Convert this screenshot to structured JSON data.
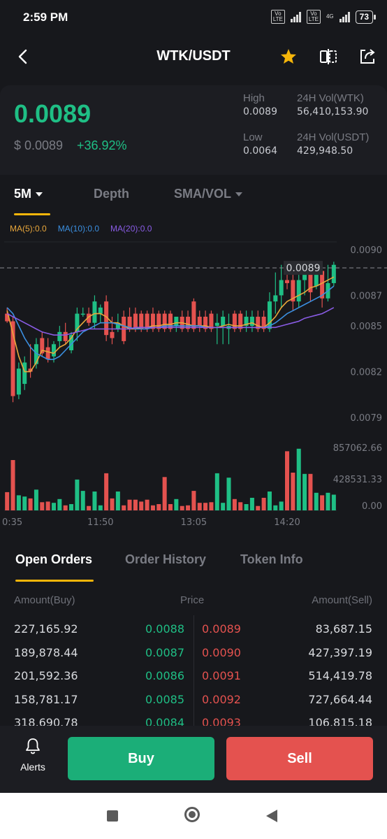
{
  "status": {
    "time": "2:59 PM",
    "sim1": "Vo\nLTE",
    "sim2": "Vo\nLTE",
    "network": "4G",
    "battery": "73"
  },
  "topbar": {
    "title": "WTK/USDT",
    "favorite_icon": "star-icon",
    "compare_icon": "compare-icon",
    "share_icon": "share-icon"
  },
  "ticker": {
    "price": "0.0089",
    "usd_price": "$ 0.0089",
    "change": "+36.92%",
    "high_label": "High",
    "high_value": "0.0089",
    "low_label": "Low",
    "low_value": "0.0064",
    "vol_base_label": "24H Vol(WTK)",
    "vol_base_value": "56,410,153.90",
    "vol_quote_label": "24H Vol(USDT)",
    "vol_quote_value": "429,948.50"
  },
  "chart_tabs": {
    "interval": "5M",
    "depth": "Depth",
    "indicator": "SMA/VOL"
  },
  "ma_legend": {
    "ma5": "MA(5):0.0",
    "ma10": "MA(10):0.0",
    "ma20": "MA(20):0.0"
  },
  "colors": {
    "up": "#1fbf85",
    "down": "#e4524f",
    "ma5": "#e9a73b",
    "ma10": "#3b8fe0",
    "ma20": "#8a5ce6",
    "accent": "#f5b50a"
  },
  "chart_data": {
    "type": "candlestick",
    "y_ticks": [
      "0.0090",
      "0.0087",
      "0.0085",
      "0.0082",
      "0.0079"
    ],
    "ylim": [
      0.00785,
      0.00905
    ],
    "last_price_label": "0.0089",
    "last_price": 0.00888,
    "x_ticks": [
      "0:35",
      "11:50",
      "13:05",
      "14:20"
    ],
    "x_tick_index": [
      0,
      16,
      32,
      48
    ],
    "volume_ticks": [
      "857062.66",
      "428531.33",
      "0.00"
    ],
    "volume_max": 857062.66,
    "candles": [
      {
        "o": 0.00858,
        "h": 0.00862,
        "l": 0.00852,
        "c": 0.00853
      },
      {
        "o": 0.00853,
        "h": 0.00856,
        "l": 0.008,
        "c": 0.00804
      },
      {
        "o": 0.00805,
        "h": 0.00826,
        "l": 0.00802,
        "c": 0.00822
      },
      {
        "o": 0.00812,
        "h": 0.0083,
        "l": 0.00808,
        "c": 0.00826
      },
      {
        "o": 0.00822,
        "h": 0.00838,
        "l": 0.00816,
        "c": 0.0082
      },
      {
        "o": 0.00825,
        "h": 0.00842,
        "l": 0.00822,
        "c": 0.00838
      },
      {
        "o": 0.00842,
        "h": 0.00846,
        "l": 0.0083,
        "c": 0.00832
      },
      {
        "o": 0.00836,
        "h": 0.00842,
        "l": 0.00826,
        "c": 0.00828
      },
      {
        "o": 0.0083,
        "h": 0.0084,
        "l": 0.00826,
        "c": 0.00838
      },
      {
        "o": 0.0084,
        "h": 0.0085,
        "l": 0.00836,
        "c": 0.00846
      },
      {
        "o": 0.00846,
        "h": 0.00852,
        "l": 0.00838,
        "c": 0.0084
      },
      {
        "o": 0.00834,
        "h": 0.00846,
        "l": 0.00832,
        "c": 0.00844
      },
      {
        "o": 0.00846,
        "h": 0.00862,
        "l": 0.0084,
        "c": 0.00858
      },
      {
        "o": 0.00858,
        "h": 0.00862,
        "l": 0.00856,
        "c": 0.00858
      },
      {
        "o": 0.00858,
        "h": 0.00862,
        "l": 0.0085,
        "c": 0.00852
      },
      {
        "o": 0.00852,
        "h": 0.0087,
        "l": 0.00848,
        "c": 0.00866
      },
      {
        "o": 0.00858,
        "h": 0.00864,
        "l": 0.00852,
        "c": 0.00862
      },
      {
        "o": 0.00866,
        "h": 0.0087,
        "l": 0.0084,
        "c": 0.00844
      },
      {
        "o": 0.00846,
        "h": 0.00856,
        "l": 0.00838,
        "c": 0.00842
      },
      {
        "o": 0.00848,
        "h": 0.00858,
        "l": 0.00846,
        "c": 0.00852
      },
      {
        "o": 0.00856,
        "h": 0.0086,
        "l": 0.00838,
        "c": 0.0084
      },
      {
        "o": 0.00856,
        "h": 0.00862,
        "l": 0.00846,
        "c": 0.00848
      },
      {
        "o": 0.00858,
        "h": 0.00862,
        "l": 0.00846,
        "c": 0.00848
      },
      {
        "o": 0.00858,
        "h": 0.0086,
        "l": 0.00846,
        "c": 0.00848
      },
      {
        "o": 0.00858,
        "h": 0.0086,
        "l": 0.00846,
        "c": 0.00848
      },
      {
        "o": 0.00858,
        "h": 0.00862,
        "l": 0.00846,
        "c": 0.00848
      },
      {
        "o": 0.00858,
        "h": 0.0086,
        "l": 0.00846,
        "c": 0.00848
      },
      {
        "o": 0.00858,
        "h": 0.0086,
        "l": 0.00846,
        "c": 0.00848
      },
      {
        "o": 0.00858,
        "h": 0.0086,
        "l": 0.00846,
        "c": 0.00848
      },
      {
        "o": 0.0085,
        "h": 0.00856,
        "l": 0.00846,
        "c": 0.00856
      },
      {
        "o": 0.00856,
        "h": 0.0086,
        "l": 0.00846,
        "c": 0.00848
      },
      {
        "o": 0.00856,
        "h": 0.0086,
        "l": 0.00846,
        "c": 0.00848
      },
      {
        "o": 0.00866,
        "h": 0.00868,
        "l": 0.00846,
        "c": 0.00848
      },
      {
        "o": 0.00856,
        "h": 0.0086,
        "l": 0.00846,
        "c": 0.0085
      },
      {
        "o": 0.00856,
        "h": 0.0086,
        "l": 0.00846,
        "c": 0.00848
      },
      {
        "o": 0.00858,
        "h": 0.0086,
        "l": 0.00846,
        "c": 0.00848
      },
      {
        "o": 0.0085,
        "h": 0.00858,
        "l": 0.00838,
        "c": 0.00852
      },
      {
        "o": 0.0085,
        "h": 0.0086,
        "l": 0.00838,
        "c": 0.00856
      },
      {
        "o": 0.00848,
        "h": 0.00858,
        "l": 0.00838,
        "c": 0.0085
      },
      {
        "o": 0.00858,
        "h": 0.0086,
        "l": 0.00846,
        "c": 0.00848
      },
      {
        "o": 0.00858,
        "h": 0.0086,
        "l": 0.00846,
        "c": 0.00848
      },
      {
        "o": 0.0085,
        "h": 0.0086,
        "l": 0.00846,
        "c": 0.00856
      },
      {
        "o": 0.0085,
        "h": 0.0086,
        "l": 0.00846,
        "c": 0.00856
      },
      {
        "o": 0.00856,
        "h": 0.0086,
        "l": 0.00846,
        "c": 0.00848
      },
      {
        "o": 0.00856,
        "h": 0.0086,
        "l": 0.00846,
        "c": 0.00848
      },
      {
        "o": 0.00848,
        "h": 0.00872,
        "l": 0.00846,
        "c": 0.00866
      },
      {
        "o": 0.00866,
        "h": 0.00885,
        "l": 0.00858,
        "c": 0.0087
      },
      {
        "o": 0.0087,
        "h": 0.0089,
        "l": 0.00862,
        "c": 0.0088
      },
      {
        "o": 0.0088,
        "h": 0.0089,
        "l": 0.00874,
        "c": 0.00878
      },
      {
        "o": 0.0088,
        "h": 0.0089,
        "l": 0.0086,
        "c": 0.00866
      },
      {
        "o": 0.00866,
        "h": 0.00884,
        "l": 0.00862,
        "c": 0.0088
      },
      {
        "o": 0.0088,
        "h": 0.0089,
        "l": 0.0087,
        "c": 0.00886
      },
      {
        "o": 0.00886,
        "h": 0.0089,
        "l": 0.00866,
        "c": 0.00872
      },
      {
        "o": 0.00876,
        "h": 0.0089,
        "l": 0.00874,
        "c": 0.00886
      },
      {
        "o": 0.00886,
        "h": 0.0089,
        "l": 0.00862,
        "c": 0.00868
      },
      {
        "o": 0.00868,
        "h": 0.0089,
        "l": 0.00866,
        "c": 0.00878
      },
      {
        "o": 0.00878,
        "h": 0.00892,
        "l": 0.00876,
        "c": 0.0089
      }
    ],
    "volumes": [
      0.29,
      0.8,
      0.24,
      0.22,
      0.19,
      0.33,
      0.13,
      0.14,
      0.12,
      0.18,
      0.08,
      0.1,
      0.49,
      0.31,
      0.07,
      0.3,
      0.08,
      0.59,
      0.19,
      0.3,
      0.08,
      0.17,
      0.17,
      0.14,
      0.17,
      0.08,
      0.1,
      0.53,
      0.1,
      0.18,
      0.07,
      0.08,
      0.31,
      0.12,
      0.12,
      0.13,
      0.59,
      0.12,
      0.52,
      0.18,
      0.13,
      0.1,
      0.2,
      0.07,
      0.2,
      0.3,
      0.08,
      0.14,
      0.94,
      0.6,
      0.98,
      0.58,
      0.58,
      0.28,
      0.24,
      0.28,
      0.25
    ],
    "ma5": [
      0.0086,
      0.00845,
      0.0083,
      0.0082,
      0.0082,
      0.00826,
      0.00834,
      0.00833,
      0.00832,
      0.00836,
      0.00838,
      0.00842,
      0.00848,
      0.00852,
      0.00856,
      0.00858,
      0.00858,
      0.00856,
      0.00852,
      0.00852,
      0.0085,
      0.00848,
      0.00848,
      0.00849,
      0.00849,
      0.0085,
      0.0085,
      0.00851,
      0.00851,
      0.00852,
      0.00852,
      0.00851,
      0.0085,
      0.0085,
      0.0085,
      0.00849,
      0.00849,
      0.0085,
      0.00851,
      0.0085,
      0.0085,
      0.00851,
      0.00852,
      0.0085,
      0.00849,
      0.00852,
      0.00856,
      0.00862,
      0.00866,
      0.00868,
      0.0087,
      0.00872,
      0.00875,
      0.00876,
      0.00878,
      0.0088,
      0.00882
    ],
    "ma10": [
      0.00862,
      0.00858,
      0.0085,
      0.00842,
      0.00836,
      0.00832,
      0.0083,
      0.00828,
      0.00828,
      0.0083,
      0.00834,
      0.00838,
      0.00842,
      0.00846,
      0.00848,
      0.0085,
      0.00852,
      0.00852,
      0.00852,
      0.00851,
      0.0085,
      0.00849,
      0.00848,
      0.00848,
      0.00848,
      0.00849,
      0.00849,
      0.0085,
      0.0085,
      0.0085,
      0.0085,
      0.0085,
      0.0085,
      0.0085,
      0.00849,
      0.00849,
      0.00849,
      0.00849,
      0.00849,
      0.00849,
      0.00849,
      0.00849,
      0.00849,
      0.00849,
      0.00849,
      0.0085,
      0.00852,
      0.00855,
      0.00858,
      0.0086,
      0.00862,
      0.00864,
      0.00866,
      0.00868,
      0.0087,
      0.00873,
      0.00876
    ],
    "ma20": [
      0.00858,
      0.00856,
      0.00854,
      0.00852,
      0.0085,
      0.00848,
      0.00846,
      0.00845,
      0.00844,
      0.00844,
      0.00844,
      0.00845,
      0.00846,
      0.00847,
      0.00848,
      0.00848,
      0.00848,
      0.00848,
      0.00848,
      0.00848,
      0.00848,
      0.00848,
      0.00849,
      0.00849,
      0.00849,
      0.00849,
      0.00849,
      0.00849,
      0.00849,
      0.00849,
      0.00849,
      0.00849,
      0.00849,
      0.00849,
      0.00849,
      0.00849,
      0.00849,
      0.00849,
      0.00849,
      0.00849,
      0.00849,
      0.00849,
      0.00849,
      0.00849,
      0.00849,
      0.00849,
      0.00849,
      0.0085,
      0.00851,
      0.00852,
      0.00853,
      0.00855,
      0.00856,
      0.00857,
      0.00858,
      0.0086,
      0.00862
    ]
  },
  "order_tabs": {
    "open": "Open Orders",
    "history": "Order History",
    "token": "Token Info"
  },
  "orderbook": {
    "head_buy": "Amount(Buy)",
    "head_price": "Price",
    "head_sell": "Amount(Sell)",
    "rows": [
      {
        "buy_amount": "227,165.92",
        "bid": "0.0088",
        "ask": "0.0089",
        "sell_amount": "83,687.15"
      },
      {
        "buy_amount": "189,878.44",
        "bid": "0.0087",
        "ask": "0.0090",
        "sell_amount": "427,397.19"
      },
      {
        "buy_amount": "201,592.36",
        "bid": "0.0086",
        "ask": "0.0091",
        "sell_amount": "514,419.78"
      },
      {
        "buy_amount": "158,781.17",
        "bid": "0.0085",
        "ask": "0.0092",
        "sell_amount": "727,664.44"
      },
      {
        "buy_amount": "318,690.78",
        "bid": "0.0084",
        "ask": "0.0093",
        "sell_amount": "106,815.18"
      }
    ]
  },
  "bottom": {
    "alerts": "Alerts",
    "buy": "Buy",
    "sell": "Sell"
  }
}
